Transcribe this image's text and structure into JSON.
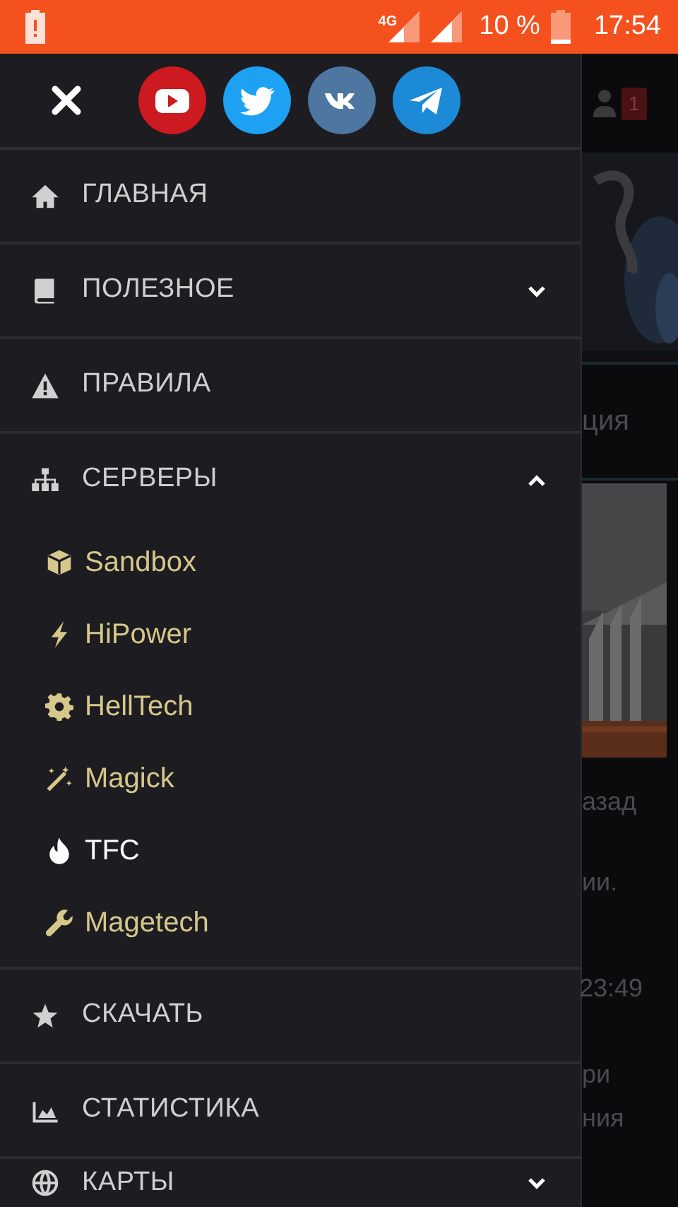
{
  "status_bar": {
    "battery_percent": "10 %",
    "time": "17:54",
    "network": "4G"
  },
  "drawer": {
    "social": [
      {
        "kind": "youtube"
      },
      {
        "kind": "twitter"
      },
      {
        "kind": "vk"
      },
      {
        "kind": "telegram"
      }
    ],
    "menu": [
      {
        "label": "ГЛАВНАЯ"
      },
      {
        "label": "ПОЛЕЗНОЕ",
        "expanded": false
      },
      {
        "label": "ПРАВИЛА"
      },
      {
        "label": "СЕРВЕРЫ",
        "expanded": true,
        "children": [
          {
            "label": "Sandbox",
            "selected": false
          },
          {
            "label": "HiPower",
            "selected": false
          },
          {
            "label": "HellTech",
            "selected": false
          },
          {
            "label": "Magick",
            "selected": false
          },
          {
            "label": "TFC",
            "selected": true
          },
          {
            "label": "Magetech",
            "selected": false
          }
        ]
      },
      {
        "label": "СКАЧАТЬ"
      },
      {
        "label": "СТАТИСТИКА"
      },
      {
        "label": "КАРТЫ",
        "expanded": false
      }
    ]
  },
  "background_page": {
    "notification_count": "1",
    "tab_text": "ция",
    "news_texts": [
      "азад",
      "ии.",
      "23:49",
      "ри",
      "ния"
    ]
  }
}
